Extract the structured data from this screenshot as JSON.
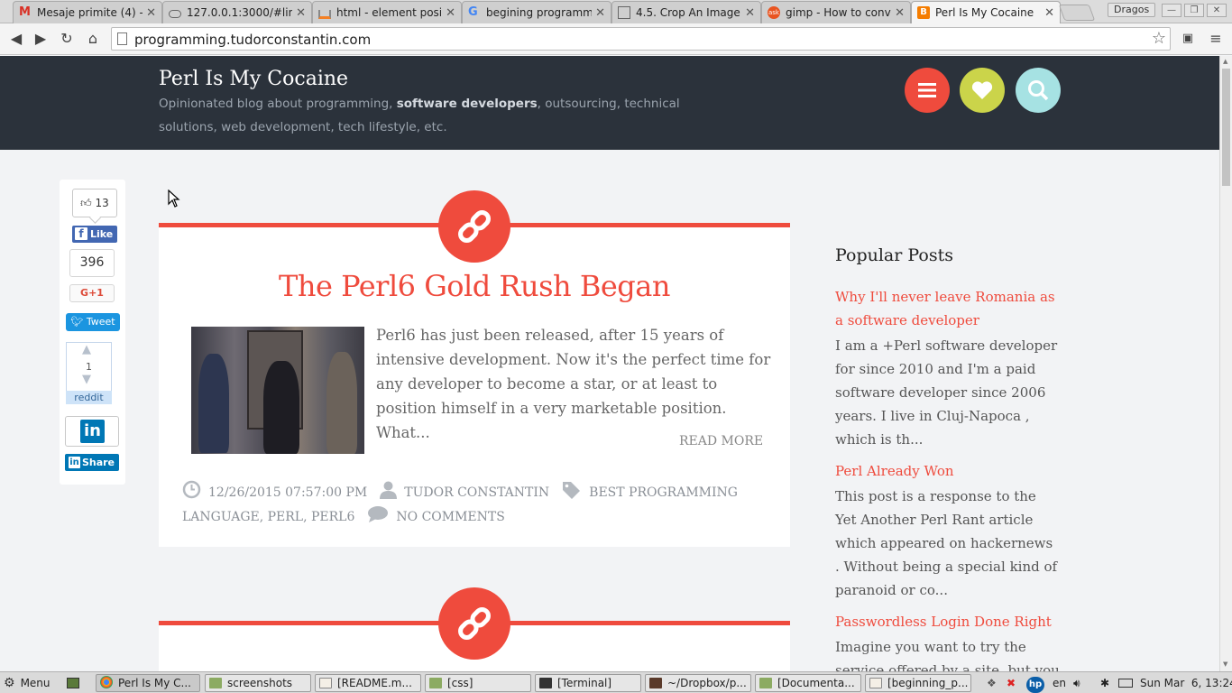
{
  "browser": {
    "tabs": [
      {
        "title": "Mesaje primite (4) -",
        "icon": "gmail-icon",
        "active": false
      },
      {
        "title": "127.0.0.1:3000/#lin",
        "icon": "cloud-icon",
        "active": false
      },
      {
        "title": "html - element posit",
        "icon": "stackoverflow-icon",
        "active": false
      },
      {
        "title": "begining programm",
        "icon": "google-icon",
        "active": false
      },
      {
        "title": "4.5. Crop An Image",
        "icon": "document-icon",
        "active": false
      },
      {
        "title": "gimp - How to conve",
        "icon": "askubuntu-icon",
        "active": false
      },
      {
        "title": "Perl Is My Cocaine",
        "icon": "blogger-icon",
        "active": true
      }
    ],
    "profile_name": "Dragos",
    "url": "programming.tudorconstantin.com"
  },
  "site": {
    "title": "Perl Is My Cocaine",
    "desc_before": "Opinionated blog about programming, ",
    "desc_bold": "software developers",
    "desc_after": ", outsourcing, technical solutions, web development, tech lifestyle, etc."
  },
  "header_buttons": [
    {
      "name": "menu-button",
      "icon": "hamburger-icon",
      "color": "#ef4b3d"
    },
    {
      "name": "favorites-button",
      "icon": "heart-icon",
      "color": "#cbd44a"
    },
    {
      "name": "search-button",
      "icon": "search-icon",
      "color": "#a6e2e3"
    }
  ],
  "share": {
    "fb_count": "13",
    "fb_like": "Like",
    "gplus_count": "396",
    "gplus_label": "G+1",
    "tweet_label": "Tweet",
    "reddit_count": "1",
    "reddit_label": "reddit",
    "linkedin_label": "Share"
  },
  "post": {
    "title": "The Perl6 Gold Rush Began",
    "excerpt": "Perl6 has just been released, after 15 years of intensive development. Now it's the perfect time for any developer to become a star, or at least to position himself in a very marketable position. What...",
    "read_more": "READ MORE",
    "date": "12/26/2015 07:57:00 PM",
    "author": "TUDOR CONSTANTIN",
    "tags": "BEST PROGRAMMING LANGUAGE, PERL, PERL6",
    "comments": "NO COMMENTS"
  },
  "sidebar": {
    "heading": "Popular Posts",
    "posts": [
      {
        "title": "Why I'll never leave Romania as a software developer",
        "snippet": "I am a  +Perl  software developer for since 2010 and I'm a paid software developer since 2006 years. I live in Cluj-Napoca , which is th..."
      },
      {
        "title": "Perl Already Won",
        "snippet": "This post is a response to the Yet Another Perl Rant article which appeared on hackernews . Without being a special kind of paranoid or co..."
      },
      {
        "title": "Passwordless Login Done Right",
        "snippet": "Imagine you want to try the service offered by a site, but you have to log"
      }
    ]
  },
  "taskbar": {
    "menu_label": "Menu",
    "tasks": [
      {
        "label": "Perl Is My C...",
        "icon": "chrome-icon",
        "active": true
      },
      {
        "label": "screenshots",
        "icon": "folder-icon",
        "active": false
      },
      {
        "label": "[README.m...",
        "icon": "text-editor-icon",
        "active": false
      },
      {
        "label": "[css]",
        "icon": "folder-icon",
        "active": false
      },
      {
        "label": "[Terminal]",
        "icon": "terminal-icon",
        "active": false
      },
      {
        "label": "~/Dropbox/p...",
        "icon": "editor-icon",
        "active": false
      },
      {
        "label": "[Documenta...",
        "icon": "folder-icon",
        "active": false
      },
      {
        "label": "[beginning_p...",
        "icon": "text-editor-icon",
        "active": false
      }
    ],
    "keyboard_layout": "en",
    "clock": "Sun Mar  6, 13:24"
  }
}
